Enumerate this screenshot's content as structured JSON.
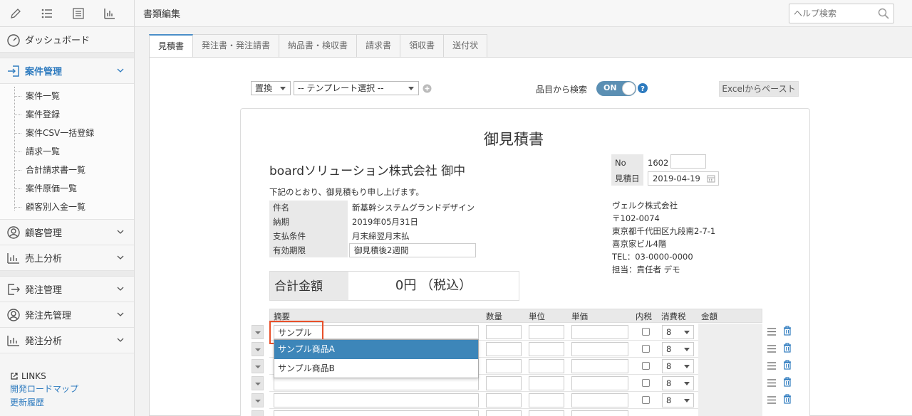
{
  "sidebar": {
    "toolbar_icons": [
      "pencil-icon",
      "list-icon",
      "detail-list-icon",
      "bar-chart-icon"
    ],
    "dashboard": "ダッシュボード",
    "case_mgmt": "案件管理",
    "sub_items": [
      "案件一覧",
      "案件登録",
      "案件CSV一括登録",
      "請求一覧",
      "合計請求書一覧",
      "案件原価一覧",
      "顧客別入金一覧"
    ],
    "customer_mgmt": "顧客管理",
    "sales_analysis": "売上分析",
    "order_mgmt": "発注管理",
    "vendor_mgmt": "発注先管理",
    "order_analysis": "発注分析",
    "links_header": "LINKS",
    "links": [
      "開発ロードマップ",
      "更新履歴"
    ]
  },
  "topbar": {
    "title": "書類編集",
    "help_placeholder": "ヘルプ検索"
  },
  "tabs": [
    "見積書",
    "発注書・発注請書",
    "納品書・検収書",
    "請求書",
    "領収書",
    "送付状"
  ],
  "controls": {
    "replace": "置換",
    "template": "-- テンプレート選択 --",
    "search_label": "品目から検索",
    "toggle": "ON",
    "excel": "Excelからペースト"
  },
  "document": {
    "title": "御見積書",
    "client": "boardソリューション株式会社 御中",
    "greeting": "下記のとおり、御見積もり申し上げます。",
    "info": [
      {
        "label": "件名",
        "value": "新基幹システムグランドデザイン"
      },
      {
        "label": "納期",
        "value": "2019年05月31日"
      },
      {
        "label": "支払条件",
        "value": "月末締翌月末払"
      },
      {
        "label": "有効期限",
        "value": "御見積後2週間"
      }
    ],
    "meta": {
      "no_label": "No",
      "no_value": "1602",
      "date_label": "見積日",
      "date_value": "2019-04-19"
    },
    "company": [
      "ヴェルク株式会社",
      "〒102-0074",
      "東京都千代田区九段南2-7-1",
      "喜京家ビル4階",
      "TEL：03-0000-0000",
      "担当：責任者 デモ"
    ],
    "total_label": "合計金額",
    "total_value": "0円 （税込）"
  },
  "items_table": {
    "headers": [
      "摘要",
      "数量",
      "単位",
      "単価",
      "内税",
      "消費税",
      "金額"
    ],
    "tax_default": "8",
    "input_value": "サンプル",
    "suggestions": [
      "サンプル商品A",
      "サンプル商品B"
    ]
  },
  "colors": {
    "accent": "#2e7bbf",
    "highlight": "#e8502a",
    "selected": "#3d86b9"
  }
}
